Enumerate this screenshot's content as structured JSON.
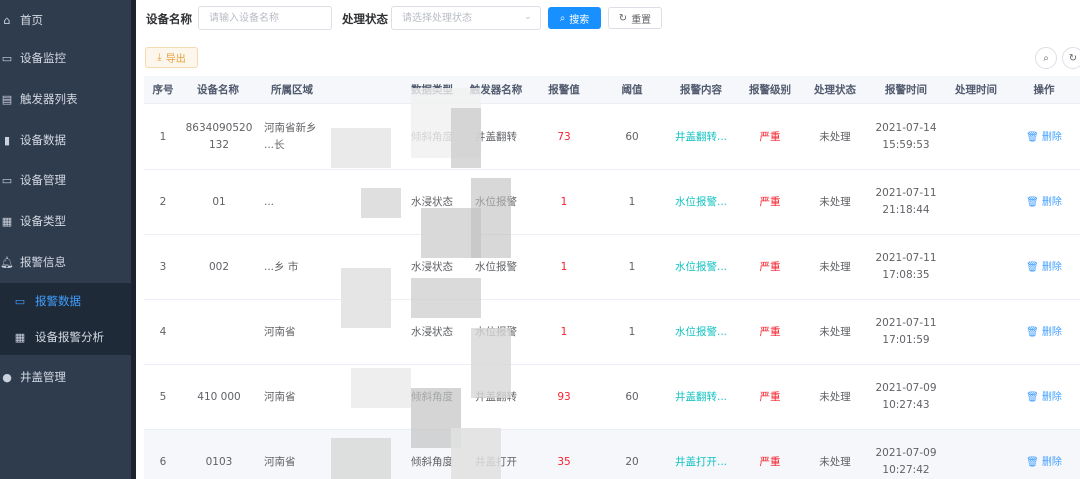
{
  "sidebar": {
    "items": [
      {
        "icon": "home-icon",
        "glyph": "⌂",
        "label": "首页"
      },
      {
        "icon": "monitor-icon",
        "glyph": "▭",
        "label": "设备监控"
      },
      {
        "icon": "list-icon",
        "glyph": "▤",
        "label": "触发器列表"
      },
      {
        "icon": "bar-chart-icon",
        "glyph": "▮",
        "label": "设备数据"
      },
      {
        "icon": "device-icon",
        "glyph": "▭",
        "label": "设备管理"
      },
      {
        "icon": "grid-icon",
        "glyph": "▦",
        "label": "设备类型"
      },
      {
        "icon": "bell-icon",
        "glyph": "🔔︎",
        "label": "报警信息"
      },
      {
        "icon": "manhole-icon",
        "glyph": "●",
        "label": "井盖管理"
      }
    ],
    "sub_items": [
      {
        "icon": "card-icon",
        "glyph": "▭",
        "label": "报警数据",
        "active": true
      },
      {
        "icon": "table-icon",
        "glyph": "▦",
        "label": "设备报警分析",
        "active": false
      }
    ]
  },
  "search": {
    "device_name_label": "设备名称",
    "device_name_placeholder": "请输入设备名称",
    "status_label": "处理状态",
    "status_placeholder": "请选择处理状态",
    "search_button": "搜索",
    "reset_button": "重置"
  },
  "toolbar": {
    "export_button": "导出"
  },
  "table": {
    "columns": [
      "序号",
      "设备名称",
      "所属区域",
      "",
      "数据类型",
      "触发器名称",
      "报警值",
      "阈值",
      "报警内容",
      "报警级别",
      "处理状态",
      "报警时间",
      "处理时间",
      "操作"
    ],
    "rows": [
      {
        "index": "1",
        "device_name": "8634090520 132",
        "region": "河南省新乡 ...长",
        "data_type": "倾斜角度",
        "trigger": "井盖翻转",
        "value": "73",
        "threshold": "60",
        "content": "井盖翻转...",
        "level": "严重",
        "status": "未处理",
        "alarm_time": "2021-07-14 15:59:53",
        "handle_time": "",
        "action": "删除"
      },
      {
        "index": "2",
        "device_name": "01",
        "region": "...",
        "data_type": "水浸状态",
        "trigger": "水位报警",
        "value": "1",
        "threshold": "1",
        "content": "水位报警...",
        "level": "严重",
        "status": "未处理",
        "alarm_time": "2021-07-11 21:18:44",
        "handle_time": "",
        "action": "删除"
      },
      {
        "index": "3",
        "device_name": "002",
        "region": "...乡 市",
        "data_type": "水浸状态",
        "trigger": "水位报警",
        "value": "1",
        "threshold": "1",
        "content": "水位报警...",
        "level": "严重",
        "status": "未处理",
        "alarm_time": "2021-07-11 17:08:35",
        "handle_time": "",
        "action": "删除"
      },
      {
        "index": "4",
        "device_name": "",
        "region": "河南省",
        "data_type": "水浸状态",
        "trigger": "水位报警",
        "value": "1",
        "threshold": "1",
        "content": "水位报警...",
        "level": "严重",
        "status": "未处理",
        "alarm_time": "2021-07-11 17:01:59",
        "handle_time": "",
        "action": "删除"
      },
      {
        "index": "5",
        "device_name": "410 000",
        "region": "河南省",
        "data_type": "倾斜角度",
        "trigger": "井盖翻转",
        "value": "93",
        "threshold": "60",
        "content": "井盖翻转...",
        "level": "严重",
        "status": "未处理",
        "alarm_time": "2021-07-09 10:27:43",
        "handle_time": "",
        "action": "删除"
      },
      {
        "index": "6",
        "device_name": "0103",
        "region": "河南省",
        "data_type": "倾斜角度",
        "trigger": "井盖打开",
        "value": "35",
        "threshold": "20",
        "content": "井盖打开...",
        "level": "严重",
        "status": "未处理",
        "alarm_time": "2021-07-09 10:27:42",
        "handle_time": "",
        "action": "删除"
      }
    ]
  },
  "colors": {
    "sidebar_bg": "#2f3c4e",
    "primary": "#1890ff",
    "danger": "#f5222d",
    "cyan": "#13c2c2",
    "warning": "#e6a23c"
  }
}
